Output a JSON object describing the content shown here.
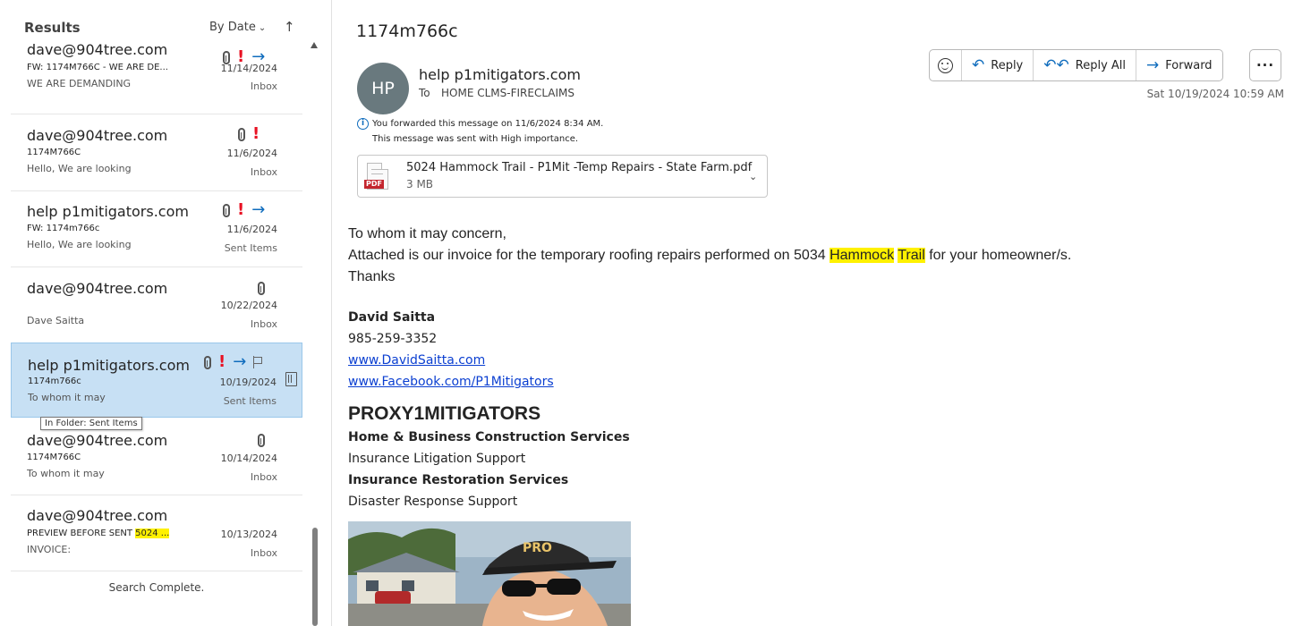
{
  "results": {
    "title": "Results",
    "sort_label": "By Date",
    "sort_direction_icon": "↑",
    "tooltip": "In Folder: Sent Items",
    "footer": "Search Complete.",
    "messages": [
      {
        "sender": "dave@904tree.com",
        "subject": "FW: 1174M766C - WE ARE DE...",
        "preview": "WE ARE DEMANDING",
        "date": "11/14/2024",
        "folder": "Inbox",
        "icons": [
          "attachment-icon",
          "importance-icon",
          "forwarded-icon"
        ]
      },
      {
        "sender": "dave@904tree.com",
        "subject": "1174M766C",
        "preview": "Hello,  We are looking",
        "date": "11/6/2024",
        "folder": "Inbox",
        "icons": [
          "attachment-icon",
          "importance-icon"
        ]
      },
      {
        "sender": "help p1mitigators.com",
        "subject": "FW: 1174m766c",
        "preview": "Hello,  We are looking",
        "date": "11/6/2024",
        "folder": "Sent Items",
        "icons": [
          "attachment-icon",
          "importance-icon",
          "forwarded-icon"
        ]
      },
      {
        "sender": "dave@904tree.com",
        "subject": "",
        "preview": "Dave Saitta",
        "date": "10/22/2024",
        "folder": "Inbox",
        "icons": [
          "attachment-icon"
        ]
      },
      {
        "sender": "help p1mitigators.com",
        "subject": "1174m766c",
        "preview": "To whom it may",
        "date": "10/19/2024",
        "folder": "Sent Items",
        "icons": [
          "attachment-icon",
          "importance-icon",
          "forwarded-icon",
          "flag-icon",
          "trash-icon"
        ],
        "selected": true
      },
      {
        "sender": "dave@904tree.com",
        "subject": "1174M766C",
        "preview": "To whom it may",
        "date": "10/14/2024",
        "folder": "Inbox",
        "icons": [
          "attachment-icon"
        ]
      },
      {
        "sender": "dave@904tree.com",
        "subject_prefix": "PREVIEW BEFORE SENT ",
        "subject_highlight": "5024 ...",
        "preview": "INVOICE:",
        "date": "10/13/2024",
        "folder": "Inbox",
        "icons": []
      }
    ]
  },
  "email": {
    "subject": "1174m766c",
    "avatar_initials": "HP",
    "from": "help p1mitigators.com",
    "to_label": "To",
    "to": "HOME CLMS-FIRECLAIMS",
    "sent_date": "Sat 10/19/2024 10:59 AM",
    "forward_note": "You forwarded this message on 11/6/2024 8:34 AM.",
    "importance_note": "This message was sent with High importance.",
    "actions": {
      "reply": "Reply",
      "reply_all": "Reply All",
      "forward": "Forward",
      "more": "···"
    },
    "attachment": {
      "name": "5024 Hammock Trail - P1Mit -Temp Repairs - State Farm.pdf",
      "size": "3 MB",
      "type_badge": "PDF"
    },
    "body": {
      "greeting": "To whom it may concern,",
      "line_prefix": "Attached is our invoice for the temporary roofing repairs performed on 5034 ",
      "highlight_1": "Hammock",
      "highlight_2": "Trail",
      "line_suffix": " for your homeowner/s.",
      "closing": "Thanks"
    },
    "signature": {
      "name": "David Saitta",
      "phone": "985-259-3352",
      "website": "www.DavidSaitta.com",
      "facebook": "www.Facebook.com/P1Mitigators",
      "company": "PROXY1MITIGATORS",
      "services": [
        {
          "text": "Home & Business Construction Services",
          "bold": true
        },
        {
          "text": "Insurance Litigation Support",
          "bold": false
        },
        {
          "text": "Insurance Restoration Services",
          "bold": true
        },
        {
          "text": "Disaster Response Support",
          "bold": false
        }
      ]
    }
  },
  "colors": {
    "accent": "#0f6cbd",
    "importance": "#e81123",
    "selected_bg": "#c7e0f4",
    "highlight": "#fff100"
  }
}
